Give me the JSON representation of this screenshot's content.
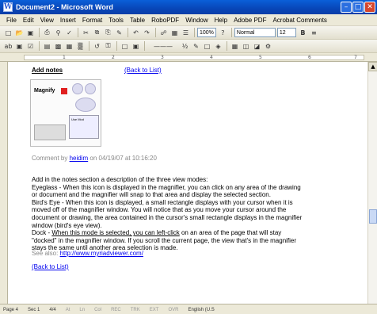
{
  "window": {
    "title": "Document2 - Microsoft Word",
    "icon_letter": "W"
  },
  "menu": [
    "File",
    "Edit",
    "View",
    "Insert",
    "Format",
    "Tools",
    "Table",
    "RoboPDF",
    "Window",
    "Help",
    "Adobe PDF",
    "Acrobat Comments"
  ],
  "toolbar": {
    "zoom": "100%",
    "style": "Normal",
    "font_size": "12"
  },
  "ruler": {
    "numbers": [
      "1",
      "2",
      "3",
      "4",
      "5",
      "6",
      "7"
    ]
  },
  "document": {
    "heading": "Add notes",
    "back_link_top": "(Back to List)",
    "thumbnail_label": "Magnify",
    "thumbnail_window_label": "Use Mod",
    "comment_prefix": "Comment by",
    "comment_user": "heidim",
    "comment_suffix": "on 04/19/07 at 10:16:20",
    "body_lines": [
      "Add in the notes section a description of the three view modes:",
      "Eyeglass - When this icon is displayed in the magnifier, you can click on any area of the drawing",
      "or document and the magnifier will snap to that area and display the selected section.",
      "Bird's Eye - When this icon is displayed, a small rectangle displays with your cursor when it is",
      "moved off of the magnifier window. You will notice that as you move your cursor around the",
      "document or drawing, the area contained in the cursor's small rectangle displays in the magnifier",
      "window (bird's eye view)."
    ],
    "dock_prefix": "Dock - ",
    "dock_underlined": "When this mode is selected, you can left-click",
    "dock_rest": " on an area of the page that will stay",
    "dock_lines": [
      "\"docked\" in the magnifier window. If you scroll the current page, the view that's in the magnifier",
      "stays the same until another area selection is made."
    ],
    "see_also_prefix": "See also: ",
    "see_also_link": "http://www.myriadviewer.com/",
    "back_link_bottom": "(Back to List)"
  },
  "status": {
    "page": "Page 4",
    "sec": "Sec 1",
    "pages": "4/4",
    "at": "At",
    "ln": "Ln",
    "col": "Col",
    "rec": "REC",
    "trk": "TRK",
    "ext": "EXT",
    "ovr": "OVR",
    "lang": "English (U.S"
  }
}
